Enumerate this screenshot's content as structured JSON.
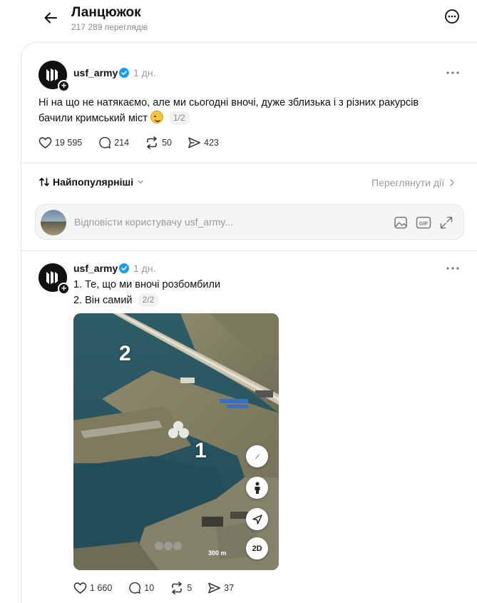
{
  "header": {
    "title": "Ланцюжок",
    "views": "217 289 переглядів"
  },
  "post": {
    "username": "usf_army",
    "time": "1 дн.",
    "text": "Ні на що не натякаємо, але ми сьогодні вночі, дуже зблизька і з різних ракурсів бачили кримський міст",
    "emoji": "smirk-emoji",
    "counter": "1/2",
    "likes": "19 595",
    "comments": "214",
    "reposts": "50",
    "shares": "423"
  },
  "sort": {
    "label": "Найпопулярніші",
    "activity_link": "Переглянути дії"
  },
  "reply": {
    "placeholder": "Відповісти користувачу usf_army..."
  },
  "reply_post": {
    "username": "usf_army",
    "time": "1 дн.",
    "line1": "1. Те, що ми вночі розбомбили",
    "line2": "2. Він самий",
    "counter": "2/2",
    "map_label_2": "2",
    "map_label_1": "1",
    "scale_label": "300 m",
    "btn_2d": "2D",
    "likes": "1 660",
    "comments": "10",
    "reposts": "5",
    "shares": "37"
  },
  "colors": {
    "text": "#101010",
    "muted": "#9a9a9a",
    "verified": "#1d9bf0",
    "border": "#e2e2e2"
  }
}
